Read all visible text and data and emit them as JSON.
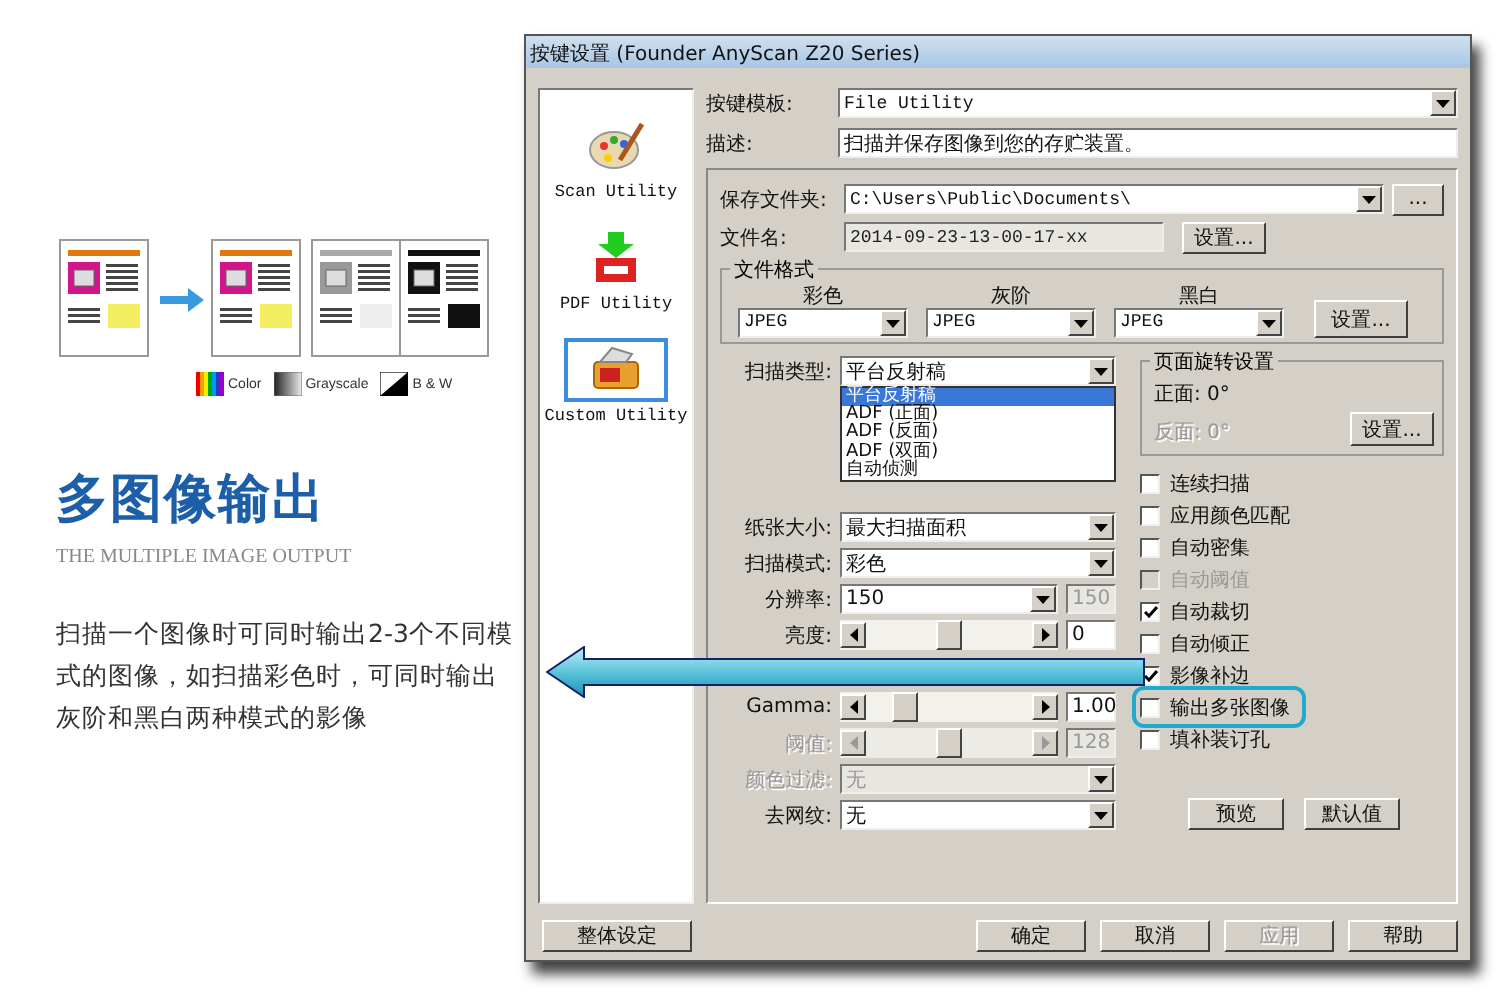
{
  "promo": {
    "legend": [
      {
        "label": "Color",
        "kind": "color"
      },
      {
        "label": "Grayscale",
        "kind": "gray"
      },
      {
        "label": "B & W",
        "kind": "bw"
      }
    ],
    "title": "多图像输出",
    "subtitle": "THE MULTIPLE IMAGE OUTPUT",
    "description": "扫描一个图像时可同时输出2-3个不同模式的图像，如扫描彩色时，可同时输出灰阶和黑白两种模式的影像"
  },
  "window": {
    "title": "按键设置 (Founder AnyScan Z20 Series)"
  },
  "sidebar": {
    "items": [
      {
        "label": "Scan Utility",
        "kind": "palette",
        "selected": false
      },
      {
        "label": "PDF Utility",
        "kind": "pdf",
        "selected": false
      },
      {
        "label": "Custom Utility",
        "kind": "custom",
        "selected": true
      }
    ]
  },
  "template": {
    "label": "按键模板:",
    "value": "File Utility"
  },
  "description": {
    "label": "描述:",
    "value": "扫描并保存图像到您的存贮装置。"
  },
  "save_folder": {
    "label": "保存文件夹:",
    "value": "C:\\Users\\Public\\Documents\\",
    "browse": "..."
  },
  "file_name": {
    "label": "文件名:",
    "value": "2014-09-23-13-00-17-xx",
    "button": "设置..."
  },
  "file_format": {
    "title": "文件格式",
    "columns": [
      {
        "heading": "彩色",
        "value": "JPEG"
      },
      {
        "heading": "灰阶",
        "value": "JPEG"
      },
      {
        "heading": "黑白",
        "value": "JPEG"
      }
    ],
    "button": "设置..."
  },
  "scan_type": {
    "label": "扫描类型:",
    "value": "平台反射稿",
    "options": [
      {
        "label": "平台反射稿",
        "selected": true
      },
      {
        "label": "ADF (正面)",
        "selected": false
      },
      {
        "label": "ADF (反面)",
        "selected": false
      },
      {
        "label": "ADF (双面)",
        "selected": false
      },
      {
        "label": "自动侦测",
        "selected": false
      }
    ]
  },
  "fields": [
    {
      "kind": "select",
      "label": "纸张大小:",
      "value": "最大扫描面积",
      "disabled": false
    },
    {
      "kind": "select",
      "label": "扫描模式:",
      "value": "彩色",
      "disabled": false
    },
    {
      "kind": "resolution",
      "label": "分辨率:",
      "value": "150",
      "reading": "150",
      "disabled": false
    },
    {
      "kind": "slider",
      "label": "亮度:",
      "level": 0.5,
      "reading": "0",
      "disabled": false
    },
    {
      "kind": "covered"
    },
    {
      "kind": "slider",
      "label": "Gamma:",
      "level": 0.3,
      "reading": "1.00",
      "disabled": false
    },
    {
      "kind": "slider",
      "label": "阈值:",
      "level": 0.5,
      "reading": "128",
      "disabled": true
    },
    {
      "kind": "select",
      "label": "颜色过滤:",
      "value": "无",
      "disabled": true
    },
    {
      "kind": "select",
      "label": "去网纹:",
      "value": "无",
      "disabled": false
    }
  ],
  "rotation": {
    "title": "页面旋转设置",
    "front": {
      "text": "正面: 0°",
      "disabled": false
    },
    "back": {
      "text": "反面: 0°",
      "disabled": true
    },
    "button": "设置..."
  },
  "options": [
    {
      "label": "连续扫描",
      "checked": false,
      "disabled": false,
      "highlighted": false
    },
    {
      "label": "应用颜色匹配",
      "checked": false,
      "disabled": false,
      "highlighted": false
    },
    {
      "label": "自动密集",
      "checked": false,
      "disabled": false,
      "highlighted": false
    },
    {
      "label": "自动阈值",
      "checked": false,
      "disabled": true,
      "highlighted": false
    },
    {
      "label": "自动裁切",
      "checked": true,
      "disabled": false,
      "highlighted": false
    },
    {
      "label": "自动倾正",
      "checked": false,
      "disabled": false,
      "highlighted": false
    },
    {
      "label": "影像补边",
      "checked": true,
      "disabled": false,
      "highlighted": false
    },
    {
      "label": "输出多张图像",
      "checked": false,
      "disabled": false,
      "highlighted": true
    },
    {
      "label": "填补装订孔",
      "checked": false,
      "disabled": false,
      "highlighted": false
    }
  ],
  "panel_buttons": [
    {
      "label": "预览",
      "disabled": false
    },
    {
      "label": "默认值",
      "disabled": false
    }
  ],
  "global_button": {
    "label": "整体设定"
  },
  "footer_buttons": [
    {
      "label": "确定",
      "disabled": false
    },
    {
      "label": "取消",
      "disabled": false
    },
    {
      "label": "应用",
      "disabled": true
    },
    {
      "label": "帮助",
      "disabled": false
    }
  ]
}
